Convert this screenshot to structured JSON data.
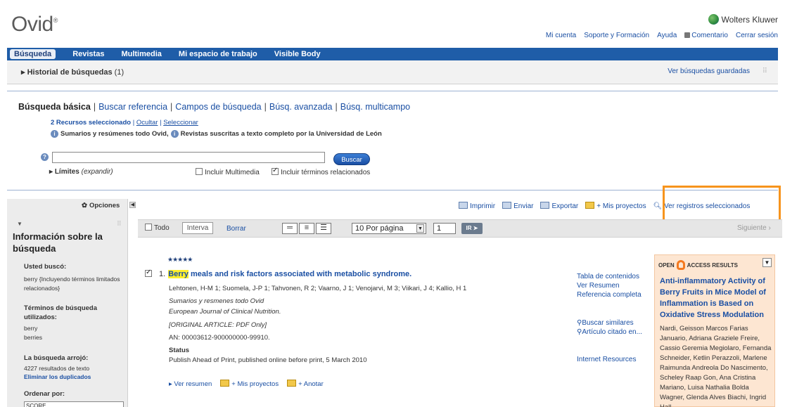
{
  "header": {
    "logo": "Ovid",
    "logo_mark": "®",
    "brand": "Wolters Kluwer",
    "links": [
      "Mi cuenta",
      "Soporte y Formación",
      "Ayuda",
      "Comentario",
      "Cerrar sesión"
    ]
  },
  "nav": {
    "items": [
      "Búsqueda",
      "Revistas",
      "Multimedia",
      "Mi espacio de trabajo",
      "Visible Body"
    ]
  },
  "history": {
    "label": "Historial de búsquedas",
    "count": "(1)",
    "saved": "Ver búsquedas guardadas"
  },
  "search": {
    "tabs": [
      "Búsqueda básica",
      "Buscar referencia",
      "Campos de búsqueda",
      "Búsq. avanzada",
      "Búsq. multicampo"
    ],
    "resources_selected": "2 Recursos seleccionado",
    "hide": "Ocultar",
    "select": "Seleccionar",
    "resource_a": "Sumarios y resúmenes todo Ovid,",
    "resource_b": "Revistas suscritas a texto completo por la Universidad de León",
    "query": "",
    "button": "Buscar",
    "limits": "Límites",
    "limits_hint": "(expandir)",
    "opt_multimedia": "Incluir Multimedia",
    "opt_related": "Incluir términos relacionados"
  },
  "left": {
    "options": "Opciones",
    "title": "Información sobre la búsqueda",
    "you_searched_h": "Usted buscó:",
    "you_searched": "berry {Incluyendo términos limitados relacionados}",
    "terms_h": "Términos de búsqueda utilizados:",
    "terms": [
      "berry",
      "berries"
    ],
    "results_h": "La búsqueda arrojó:",
    "results": "4227 resultados de texto",
    "dedupe": "Eliminar los duplicados",
    "sort_h": "Ordenar por:",
    "sort_value": "SCORE"
  },
  "toolbar": {
    "print": "Imprimir",
    "send": "Enviar",
    "export": "Exportar",
    "projects": "+ Mis proyectos",
    "view_selected": "Ver registros seleccionados",
    "all": "Todo",
    "range": "Interva",
    "clear": "Borrar",
    "per_page": "10 Por página",
    "page": "1",
    "go": "IR ➤",
    "next": "Siguiente ›"
  },
  "record": {
    "stars": "★★★★★",
    "number": "1.",
    "title_hl": "Berry",
    "title_rest": " meals and risk factors associated with metabolic syndrome.",
    "authors": "Lehtonen, H-M 1; Suomela, J-P 1; Tahvonen, R 2; Vaarno, J 1; Venojarvi, M 3; Viikari, J 4; Kallio, H 1",
    "source1": "Sumarios y resmenes todo Ovid",
    "source2": "European Journal of Clinical Nutrition.",
    "type": "[ORIGINAL ARTICLE: PDF Only]",
    "an": "AN: 00003612-900000000-99910.",
    "status_h": "Status",
    "status": "Publish Ahead of Print, published online before print, 5 March 2010",
    "links": [
      "Tabla de contenidos",
      "Ver Resumen",
      "Referencia completa"
    ],
    "links2": [
      "Buscar similares",
      "Artículo citado en..."
    ],
    "internet": "Internet Resources",
    "view_abstract": "Ver resumen",
    "my_projects": "+ Mis proyectos",
    "annotate": "+ Anotar"
  },
  "open_access": {
    "label_open": "OPEN",
    "label_rest": "ACCESS RESULTS",
    "title": "Anti-inflammatory Activity of Berry Fruits in Mice Model of Inflammation is Based on Oxidative Stress Modulation",
    "authors": "Nardi, Geisson Marcos Farias Januario, Adriana Graziele Freire, Cassio Geremia Megiolaro, Fernanda Schneider, Ketlin Perazzoli, Marlene Raimunda Andreola Do Nascimento, Scheley Raap Gon, Ana Cristina Mariano, Luisa Nathalia Bolda Wagner, Glenda Alves Biachi, Ingrid Hall..."
  },
  "colors": {
    "nav": "#1f5da8",
    "link": "#1a4fa3",
    "highlight_box": "#f7941d",
    "open_access_bg": "#fde6d2"
  }
}
